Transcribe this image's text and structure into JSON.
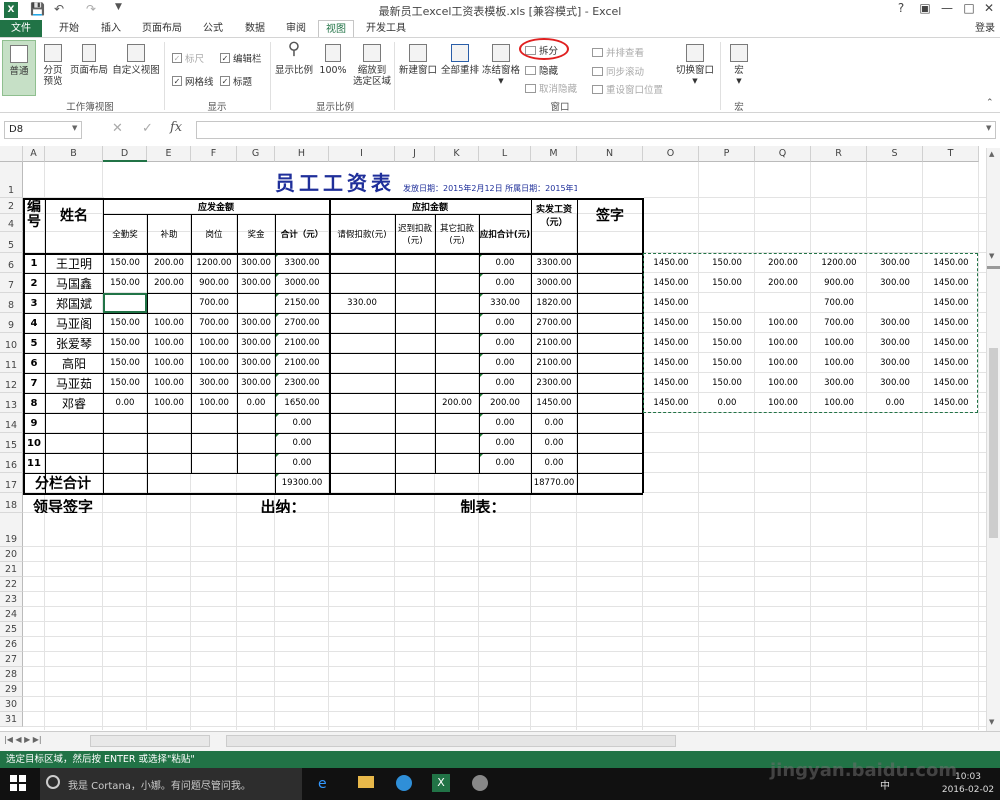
{
  "title_bar": {
    "title": "最新员工excel工资表模板.xls  [兼容模式] - Excel",
    "help": "?",
    "sign_in": "登录"
  },
  "tabs": [
    "文件",
    "开始",
    "插入",
    "页面布局",
    "公式",
    "数据",
    "审阅",
    "视图",
    "开发工具"
  ],
  "ribbon": {
    "views": {
      "normal": "普通",
      "page_break": "分页\n预览",
      "page_layout": "页面布局",
      "custom": "自定义视图",
      "group": "工作簿视图"
    },
    "show": {
      "ruler": "标尺",
      "formula_bar": "编辑栏",
      "gridlines": "网格线",
      "headings": "标题",
      "group": "显示"
    },
    "zoom": {
      "zoom": "显示比例",
      "hundred": "100%",
      "to_selection": "缩放到\n选定区域",
      "group": "显示比例"
    },
    "window": {
      "new_window": "新建窗口",
      "arrange_all": "全部重排",
      "freeze": "冻结窗格",
      "split": "拆分",
      "hide": "隐藏",
      "unhide": "取消隐藏",
      "side_by_side": "并排查看",
      "sync_scroll": "同步滚动",
      "reset_position": "重设窗口位置",
      "switch": "切换窗口",
      "group": "窗口"
    },
    "macros": {
      "macros": "宏",
      "group": "宏"
    },
    "split_highlight_color": "#e02020"
  },
  "formula_bar": {
    "name_box": "D8",
    "fx": "fx",
    "value": ""
  },
  "sheet": {
    "column_letters": [
      "A",
      "B",
      "D",
      "E",
      "F",
      "G",
      "H",
      "I",
      "J",
      "K",
      "L",
      "M",
      "N",
      "O",
      "P",
      "Q",
      "R",
      "S",
      "T"
    ],
    "row_numbers": [
      "1",
      "2",
      "4",
      "5",
      "6",
      "7",
      "8",
      "9",
      "10",
      "11",
      "12",
      "13",
      "14",
      "15",
      "16",
      "17",
      "18",
      "19",
      "20",
      "21",
      "22",
      "23",
      "24",
      "25",
      "26",
      "27",
      "28",
      "29",
      "30",
      "31"
    ],
    "title": "员工工资表",
    "issue_date": "发放日期：2015年2月12日  所属日期：2015年1月",
    "header": {
      "no": "编号",
      "name": "姓名",
      "payable": "应发金额",
      "deduct": "应扣金额",
      "net": "实发工资（元）",
      "sign": "签字",
      "sub": [
        "全勤奖",
        "补助",
        "岗位",
        "奖金",
        "合计（元）",
        "请假扣款(元)",
        "迟到扣款(元)",
        "其它扣款(元)",
        "应扣合计(元)"
      ]
    },
    "rows": [
      [
        "1",
        "王卫明",
        "150.00",
        "200.00",
        "1200.00",
        "300.00",
        "3300.00",
        "",
        "",
        "",
        "0.00",
        "3300.00"
      ],
      [
        "2",
        "马国鑫",
        "150.00",
        "200.00",
        "900.00",
        "300.00",
        "3000.00",
        "",
        "",
        "",
        "0.00",
        "3000.00"
      ],
      [
        "3",
        "郑国斌",
        "",
        "",
        "700.00",
        "",
        "2150.00",
        "330.00",
        "",
        "",
        "330.00",
        "1820.00"
      ],
      [
        "4",
        "马亚阁",
        "150.00",
        "100.00",
        "700.00",
        "300.00",
        "2700.00",
        "",
        "",
        "",
        "0.00",
        "2700.00"
      ],
      [
        "5",
        "张爱琴",
        "150.00",
        "100.00",
        "100.00",
        "300.00",
        "2100.00",
        "",
        "",
        "",
        "0.00",
        "2100.00"
      ],
      [
        "6",
        "高阳",
        "150.00",
        "100.00",
        "100.00",
        "300.00",
        "2100.00",
        "",
        "",
        "",
        "0.00",
        "2100.00"
      ],
      [
        "7",
        "马亚茹",
        "150.00",
        "100.00",
        "300.00",
        "300.00",
        "2300.00",
        "",
        "",
        "",
        "0.00",
        "2300.00"
      ],
      [
        "8",
        "邓睿",
        "0.00",
        "100.00",
        "100.00",
        "0.00",
        "1650.00",
        "",
        "",
        "200.00",
        "200.00",
        "1450.00"
      ],
      [
        "9",
        "",
        "",
        "",
        "",
        "",
        "0.00",
        "",
        "",
        "",
        "0.00",
        "0.00"
      ],
      [
        "10",
        "",
        "",
        "",
        "",
        "",
        "0.00",
        "",
        "",
        "",
        "0.00",
        "0.00"
      ],
      [
        "11",
        "",
        "",
        "",
        "",
        "",
        "0.00",
        "",
        "",
        "",
        "0.00",
        "0.00"
      ]
    ],
    "subtotal": {
      "label": "分栏合计",
      "total": "19300.00",
      "net": "18770.00"
    },
    "footer": {
      "leader": "领导签字",
      "cashier": "出纳：",
      "maker": "制表："
    },
    "copied": [
      [
        "1450.00",
        "150.00",
        "200.00",
        "1200.00",
        "300.00",
        "1450.00"
      ],
      [
        "1450.00",
        "150.00",
        "200.00",
        "900.00",
        "300.00",
        "1450.00"
      ],
      [
        "1450.00",
        "",
        "",
        "700.00",
        "",
        "1450.00"
      ],
      [
        "1450.00",
        "150.00",
        "100.00",
        "700.00",
        "300.00",
        "1450.00"
      ],
      [
        "1450.00",
        "150.00",
        "100.00",
        "100.00",
        "300.00",
        "1450.00"
      ],
      [
        "1450.00",
        "150.00",
        "100.00",
        "100.00",
        "300.00",
        "1450.00"
      ],
      [
        "1450.00",
        "150.00",
        "100.00",
        "300.00",
        "300.00",
        "1450.00"
      ],
      [
        "1450.00",
        "0.00",
        "100.00",
        "100.00",
        "0.00",
        "1450.00"
      ]
    ]
  },
  "status_bar": {
    "message": "选定目标区域，然后按 ENTER 或选择\"粘贴\""
  },
  "taskbar": {
    "search": "我是 Cortana，小娜。有问题尽管问我。",
    "time": "10:03",
    "date": "2016-02-02",
    "ime": "中"
  },
  "watermark": "jingyan.baidu.com"
}
